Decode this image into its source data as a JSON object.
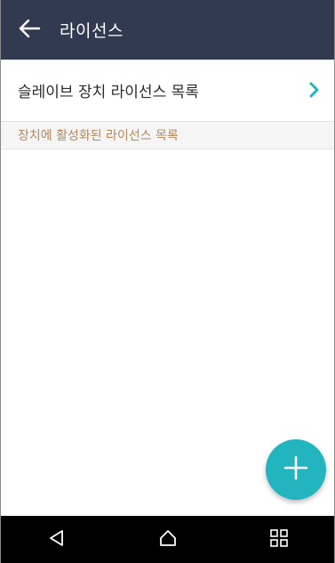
{
  "app_bar": {
    "title": "라이선스",
    "back_icon": "arrow-left-icon",
    "background": "#323a52"
  },
  "list": {
    "item_label": "슬레이브 장치 라이선스 목록",
    "chevron_icon": "chevron-right-icon",
    "accent": "#22b5bf"
  },
  "section": {
    "header_label": "장치에 활성화된 라이선스 목록",
    "header_color": "#b08a60"
  },
  "fab": {
    "icon": "plus-icon",
    "color": "#22b5bf"
  },
  "nav_bar": {
    "back_icon": "triangle-back-icon",
    "home_icon": "home-icon",
    "recents_icon": "recents-grid-icon"
  }
}
